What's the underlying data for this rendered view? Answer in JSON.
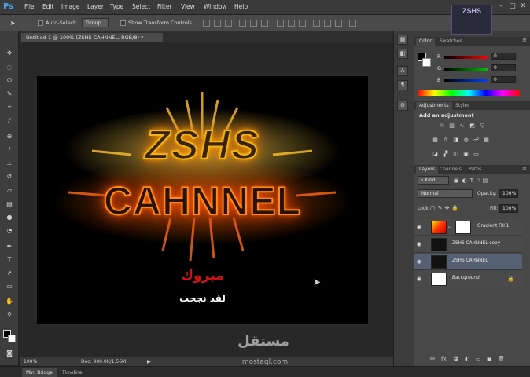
{
  "app": {
    "logo": "Ps"
  },
  "menu": [
    "File",
    "Edit",
    "Image",
    "Layer",
    "Type",
    "Select",
    "Filter",
    "View",
    "Window",
    "Help"
  ],
  "options_bar": {
    "auto_select_label": "Auto-Select:",
    "auto_select_value": "Group",
    "show_transform_label": "Show Transform Controls"
  },
  "document": {
    "tab_title": "Untitled-1 @ 100% (ZSHS CAHNNEL, RGB/8) *",
    "artwork": {
      "line1": "ZSHS",
      "line2": "CAHNNEL",
      "arabic_red": "مبروك",
      "arabic_white": "لقد نجحت"
    }
  },
  "status": {
    "zoom": "100%",
    "doc_size": "Doc: 900.0K/1.56M"
  },
  "bottom_tabs": [
    "Mini Bridge",
    "Timeline"
  ],
  "watermark": {
    "arabic": "مستقل",
    "latin": "mostaql.com"
  },
  "top_right_logo": "ZSHS",
  "color_panel": {
    "tabs": [
      "Color",
      "Swatches"
    ],
    "channels": [
      {
        "label": "R",
        "value": "0",
        "color": "#d23030"
      },
      {
        "label": "G",
        "value": "0",
        "color": "#2fb040"
      },
      {
        "label": "B",
        "value": "0",
        "color": "#3060d8"
      }
    ]
  },
  "adjustments_panel": {
    "tabs": [
      "Adjustments",
      "Styles"
    ],
    "heading": "Add an adjustment"
  },
  "layers_panel": {
    "tabs": [
      "Layers",
      "Channels",
      "Paths"
    ],
    "filter_kind": "Kind",
    "blend_mode": "Normal",
    "opacity_label": "Opacity:",
    "opacity_value": "100%",
    "lock_label": "Lock:",
    "fill_label": "Fill:",
    "fill_value": "100%",
    "layers": [
      {
        "name": "Gradient Fill 1",
        "selected": false
      },
      {
        "name": "ZSHS CAHNNEL copy",
        "selected": false
      },
      {
        "name": "ZSHS CAHNNEL",
        "selected": true
      },
      {
        "name": "Background",
        "selected": false
      }
    ]
  }
}
